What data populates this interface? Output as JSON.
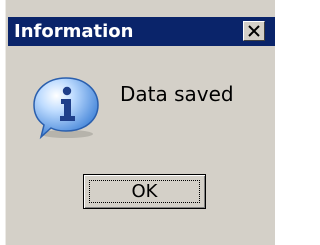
{
  "window": {
    "title": "Information"
  },
  "message": {
    "text": "Data saved",
    "icon": "information-icon"
  },
  "buttons": {
    "ok_label": "OK",
    "close_icon": "close-icon"
  },
  "colors": {
    "titlebar": "#0a246a",
    "dialog_background": "#d4d0c8",
    "icon_fill": "#4a8ee0"
  }
}
